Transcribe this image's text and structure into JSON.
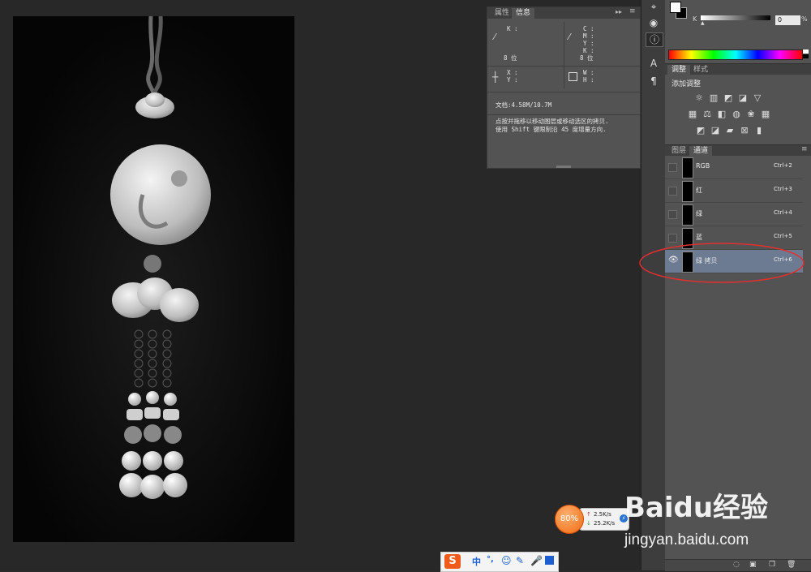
{
  "info_panel": {
    "tabs": [
      "属性",
      "信息"
    ],
    "active_tab": "信息",
    "k_label": "K :",
    "cmyk_labels": [
      "C :",
      "M :",
      "Y :",
      "K :"
    ],
    "bits_left": "8 位",
    "bits_right": "8 位",
    "xy_labels": [
      "X :",
      "Y :"
    ],
    "wh_labels": [
      "W :",
      "H :"
    ],
    "doc_size": "文档:4.58M/10.7M",
    "hint_line1": "点按并拖移以移动图层或移动选区的拷贝.",
    "hint_line2": "使用 Shift 键限制沿 45 度增量方向."
  },
  "color_panel": {
    "slider_label": "K",
    "value": "0",
    "unit": "%"
  },
  "adjust_panel": {
    "tabs": [
      "调整",
      "样式"
    ],
    "active_tab": "调整",
    "heading": "添加调整"
  },
  "channels_panel": {
    "tabs": [
      "图层",
      "通道"
    ],
    "active_tab": "通道",
    "channels": [
      {
        "name": "RGB",
        "shortcut": "Ctrl+2",
        "visible": false,
        "selected": false
      },
      {
        "name": "红",
        "shortcut": "Ctrl+3",
        "visible": false,
        "selected": false
      },
      {
        "name": "绿",
        "shortcut": "Ctrl+4",
        "visible": false,
        "selected": false
      },
      {
        "name": "蓝",
        "shortcut": "Ctrl+5",
        "visible": false,
        "selected": false
      },
      {
        "name": "绿 拷贝",
        "shortcut": "Ctrl+6",
        "visible": true,
        "selected": true
      }
    ],
    "annotation_color": "#e03030"
  },
  "net_monitor": {
    "percent": "80%",
    "up": "2.5K/s",
    "down": "25.2K/s"
  },
  "ime_bar": {
    "mode": "中",
    "punct": "°,"
  },
  "watermark": {
    "brand": "Baidu经验",
    "url": "jingyan.baidu.com"
  },
  "colors": {
    "panel_bg": "#535353",
    "selected_row": "#6c7b92",
    "canvas_bg": "#282828"
  }
}
